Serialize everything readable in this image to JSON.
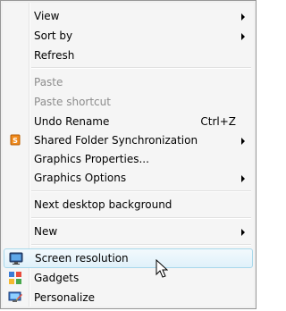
{
  "menu": {
    "items": [
      {
        "label": "View",
        "submenu": true
      },
      {
        "label": "Sort by",
        "submenu": true
      },
      {
        "label": "Refresh"
      },
      {
        "label": "Paste",
        "disabled": true
      },
      {
        "label": "Paste shortcut",
        "disabled": true
      },
      {
        "label": "Undo Rename",
        "shortcut": "Ctrl+Z"
      },
      {
        "label": "Shared Folder Synchronization",
        "submenu": true,
        "icon": "shared-folder-sync-icon"
      },
      {
        "label": "Graphics Properties..."
      },
      {
        "label": "Graphics Options",
        "submenu": true
      },
      {
        "label": "Next desktop background"
      },
      {
        "label": "New",
        "submenu": true
      },
      {
        "label": "Screen resolution",
        "icon": "screen-resolution-icon",
        "highlighted": true
      },
      {
        "label": "Gadgets",
        "icon": "gadgets-icon"
      },
      {
        "label": "Personalize",
        "icon": "personalize-icon"
      }
    ]
  },
  "colors": {
    "menu_background": "#f5f5f5",
    "border": "#979797",
    "disabled_text": "#8d8d8d",
    "highlight_border": "#a8d8eb",
    "highlight_fill": "#e0f1fa"
  }
}
